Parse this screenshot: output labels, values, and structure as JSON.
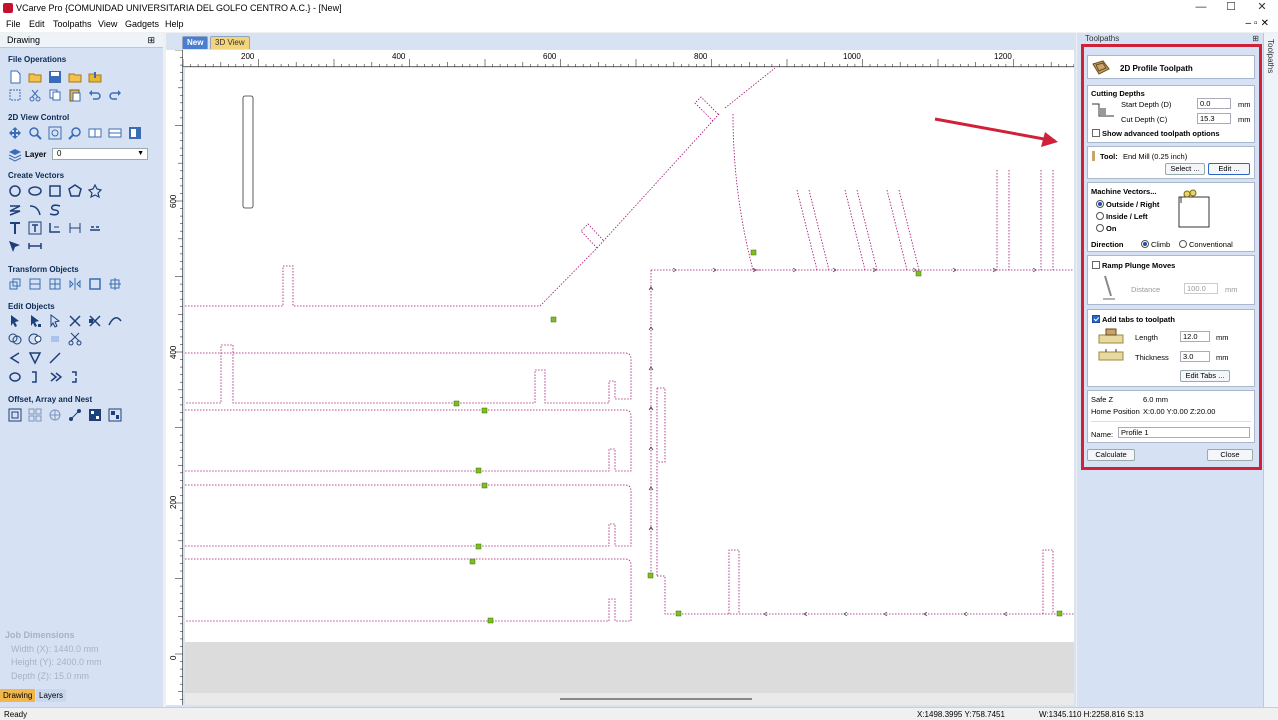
{
  "window": {
    "title": "VCarve Pro {COMUNIDAD UNIVERSITARIA DEL GOLFO CENTRO  A.C.} - [New]",
    "minimize": "—",
    "maximize": "☐",
    "close": "✕"
  },
  "menu": [
    "File",
    "Edit",
    "Toolpaths",
    "View",
    "Gadgets",
    "Help"
  ],
  "left_panel": {
    "header": "Drawing",
    "pin": "⊞",
    "sections": {
      "file_operations": "File Operations",
      "view_control": "2D View Control",
      "create_vectors": "Create Vectors",
      "transform_objects": "Transform Objects",
      "edit_objects": "Edit Objects",
      "offset": "Offset, Array and Nest"
    },
    "layer_label": "Layer",
    "layer_value": "0",
    "job_dimensions": {
      "title": "Job Dimensions",
      "width": "Width  (X): 1440.0 mm",
      "height": "Height (Y): 2400.0 mm",
      "depth": "Depth  (Z): 15.0 mm"
    },
    "tabs": [
      "Drawing",
      "Layers"
    ]
  },
  "view": {
    "tabs": [
      "New",
      "3D View"
    ],
    "h_ruler_labels": [
      "200",
      "400",
      "600",
      "800",
      "1000",
      "1200"
    ],
    "v_ruler_labels": [
      "600",
      "400",
      "200",
      "0"
    ]
  },
  "toolpaths_panel": {
    "header": "Toolpaths",
    "side_tab": "Toolpaths",
    "title": "2D Profile Toolpath",
    "cutting_depths": {
      "heading": "Cutting Depths",
      "start_label": "Start Depth (D)",
      "start_value": "0.0",
      "cut_label": "Cut Depth (C)",
      "cut_value": "15.3",
      "unit": "mm",
      "advanced_label": "Show advanced toolpath options",
      "advanced_checked": false
    },
    "tool": {
      "label": "Tool:",
      "value": "End Mill (0.25 inch)",
      "select_button": "Select ...",
      "edit_button": "Edit ..."
    },
    "machine_vectors": {
      "heading": "Machine Vectors...",
      "options": [
        "Outside / Right",
        "Inside / Left",
        "On"
      ],
      "selected": "Outside / Right",
      "direction_label": "Direction",
      "directions": [
        "Climb",
        "Conventional"
      ],
      "direction_selected": "Climb"
    },
    "ramp": {
      "label": "Ramp Plunge Moves",
      "checked": false,
      "distance_label": "Distance",
      "distance_value": "100.0",
      "unit": "mm"
    },
    "tabs": {
      "label": "Add tabs to toolpath",
      "checked": true,
      "length_label": "Length",
      "length_value": "12.0",
      "thickness_label": "Thickness",
      "thickness_value": "3.0",
      "unit": "mm",
      "edit_button": "Edit Tabs ..."
    },
    "safe_z_label": "Safe Z",
    "safe_z_value": "6.0 mm",
    "home_label": "Home Position",
    "home_value": "X:0.00 Y:0.00 Z:20.00",
    "name_label": "Name:",
    "name_value": "Profile 1",
    "calculate_button": "Calculate",
    "close_button": "Close"
  },
  "status": {
    "left": "Ready",
    "coords": "X:1498.3995 Y:758.7451",
    "dims": "W:1345.110   H:2258.816  S:13"
  },
  "colors": {
    "panel_bg": "#d6e2f3",
    "annotation_red": "#d0213a",
    "vector_magenta": "#a01070",
    "tab_marker": "#7cbf1e"
  }
}
